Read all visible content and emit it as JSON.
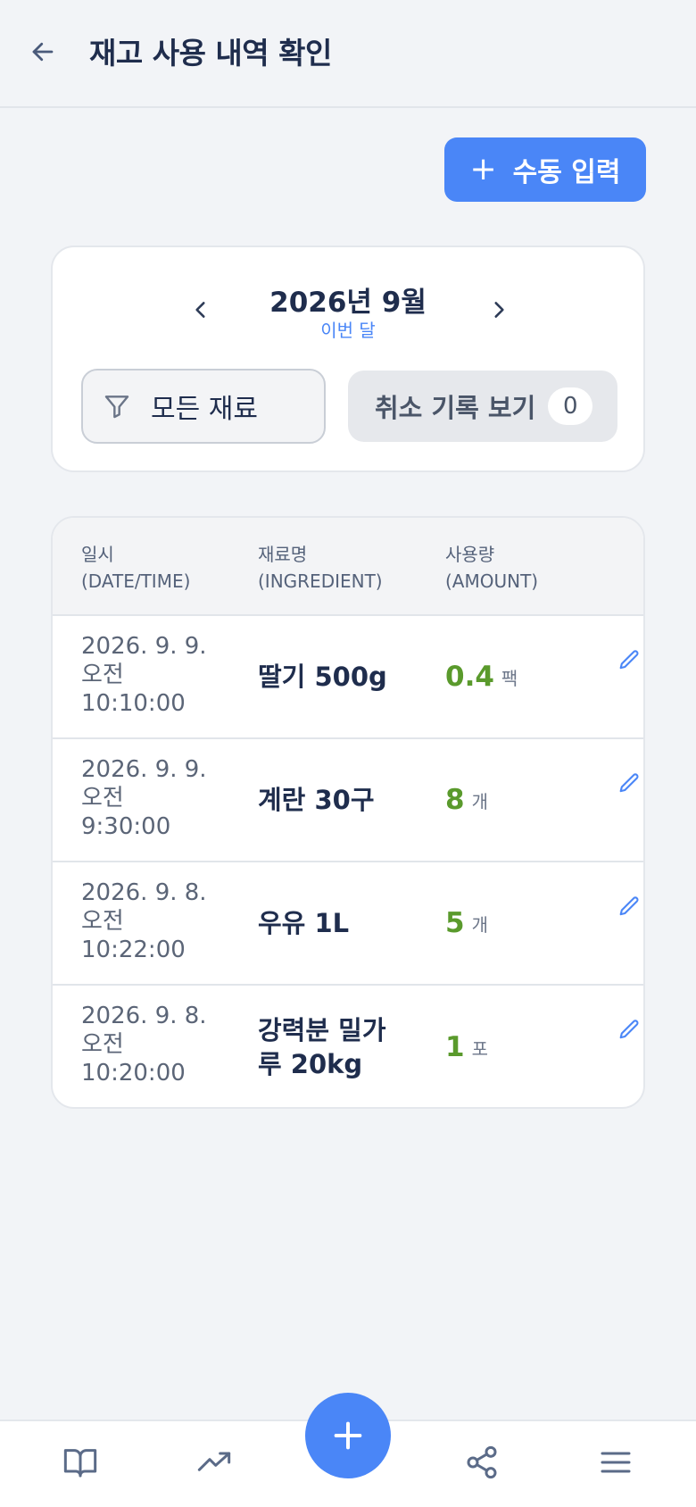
{
  "header": {
    "title": "재고 사용 내역 확인",
    "back_icon": "arrow-left-icon"
  },
  "actions": {
    "manual_input_label": "수동 입력",
    "manual_input_icon": "plus-icon"
  },
  "month_picker": {
    "title": "2026년 9월",
    "subtitle": "이번 달",
    "prev_icon": "chevron-left-icon",
    "next_icon": "chevron-right-icon"
  },
  "filters": {
    "ingredient_filter_label": "모든 재료",
    "ingredient_filter_icon": "filter-icon",
    "cancel_records_label": "취소 기록 보기",
    "cancel_records_count": "0"
  },
  "table": {
    "columns": [
      "일시\n(DATE/TIME)",
      "재료명\n(INGREDIENT)",
      "사용량\n(AMOUNT)"
    ],
    "rows": [
      {
        "datetime": "2026. 9. 9.\n오전\n10:10:00",
        "ingredient": "딸기 500g",
        "amount": "0.4",
        "unit": "팩"
      },
      {
        "datetime": "2026. 9. 9.\n오전\n9:30:00",
        "ingredient": "계란 30구",
        "amount": "8",
        "unit": "개"
      },
      {
        "datetime": "2026. 9. 8.\n오전\n10:22:00",
        "ingredient": "우유 1L",
        "amount": "5",
        "unit": "개"
      },
      {
        "datetime": "2026. 9. 8.\n오전\n10:20:00",
        "ingredient": "강력분 밀가루 20kg",
        "amount": "1",
        "unit": "포"
      }
    ]
  },
  "bottom_nav": {
    "items": [
      "book-icon",
      "trending-up-icon",
      "share-icon",
      "menu-icon"
    ],
    "fab_icon": "plus-icon"
  },
  "colors": {
    "accent": "#4a86f7",
    "amount": "#5a9a2c",
    "text": "#1f2d4d",
    "background": "#f2f4f7"
  }
}
